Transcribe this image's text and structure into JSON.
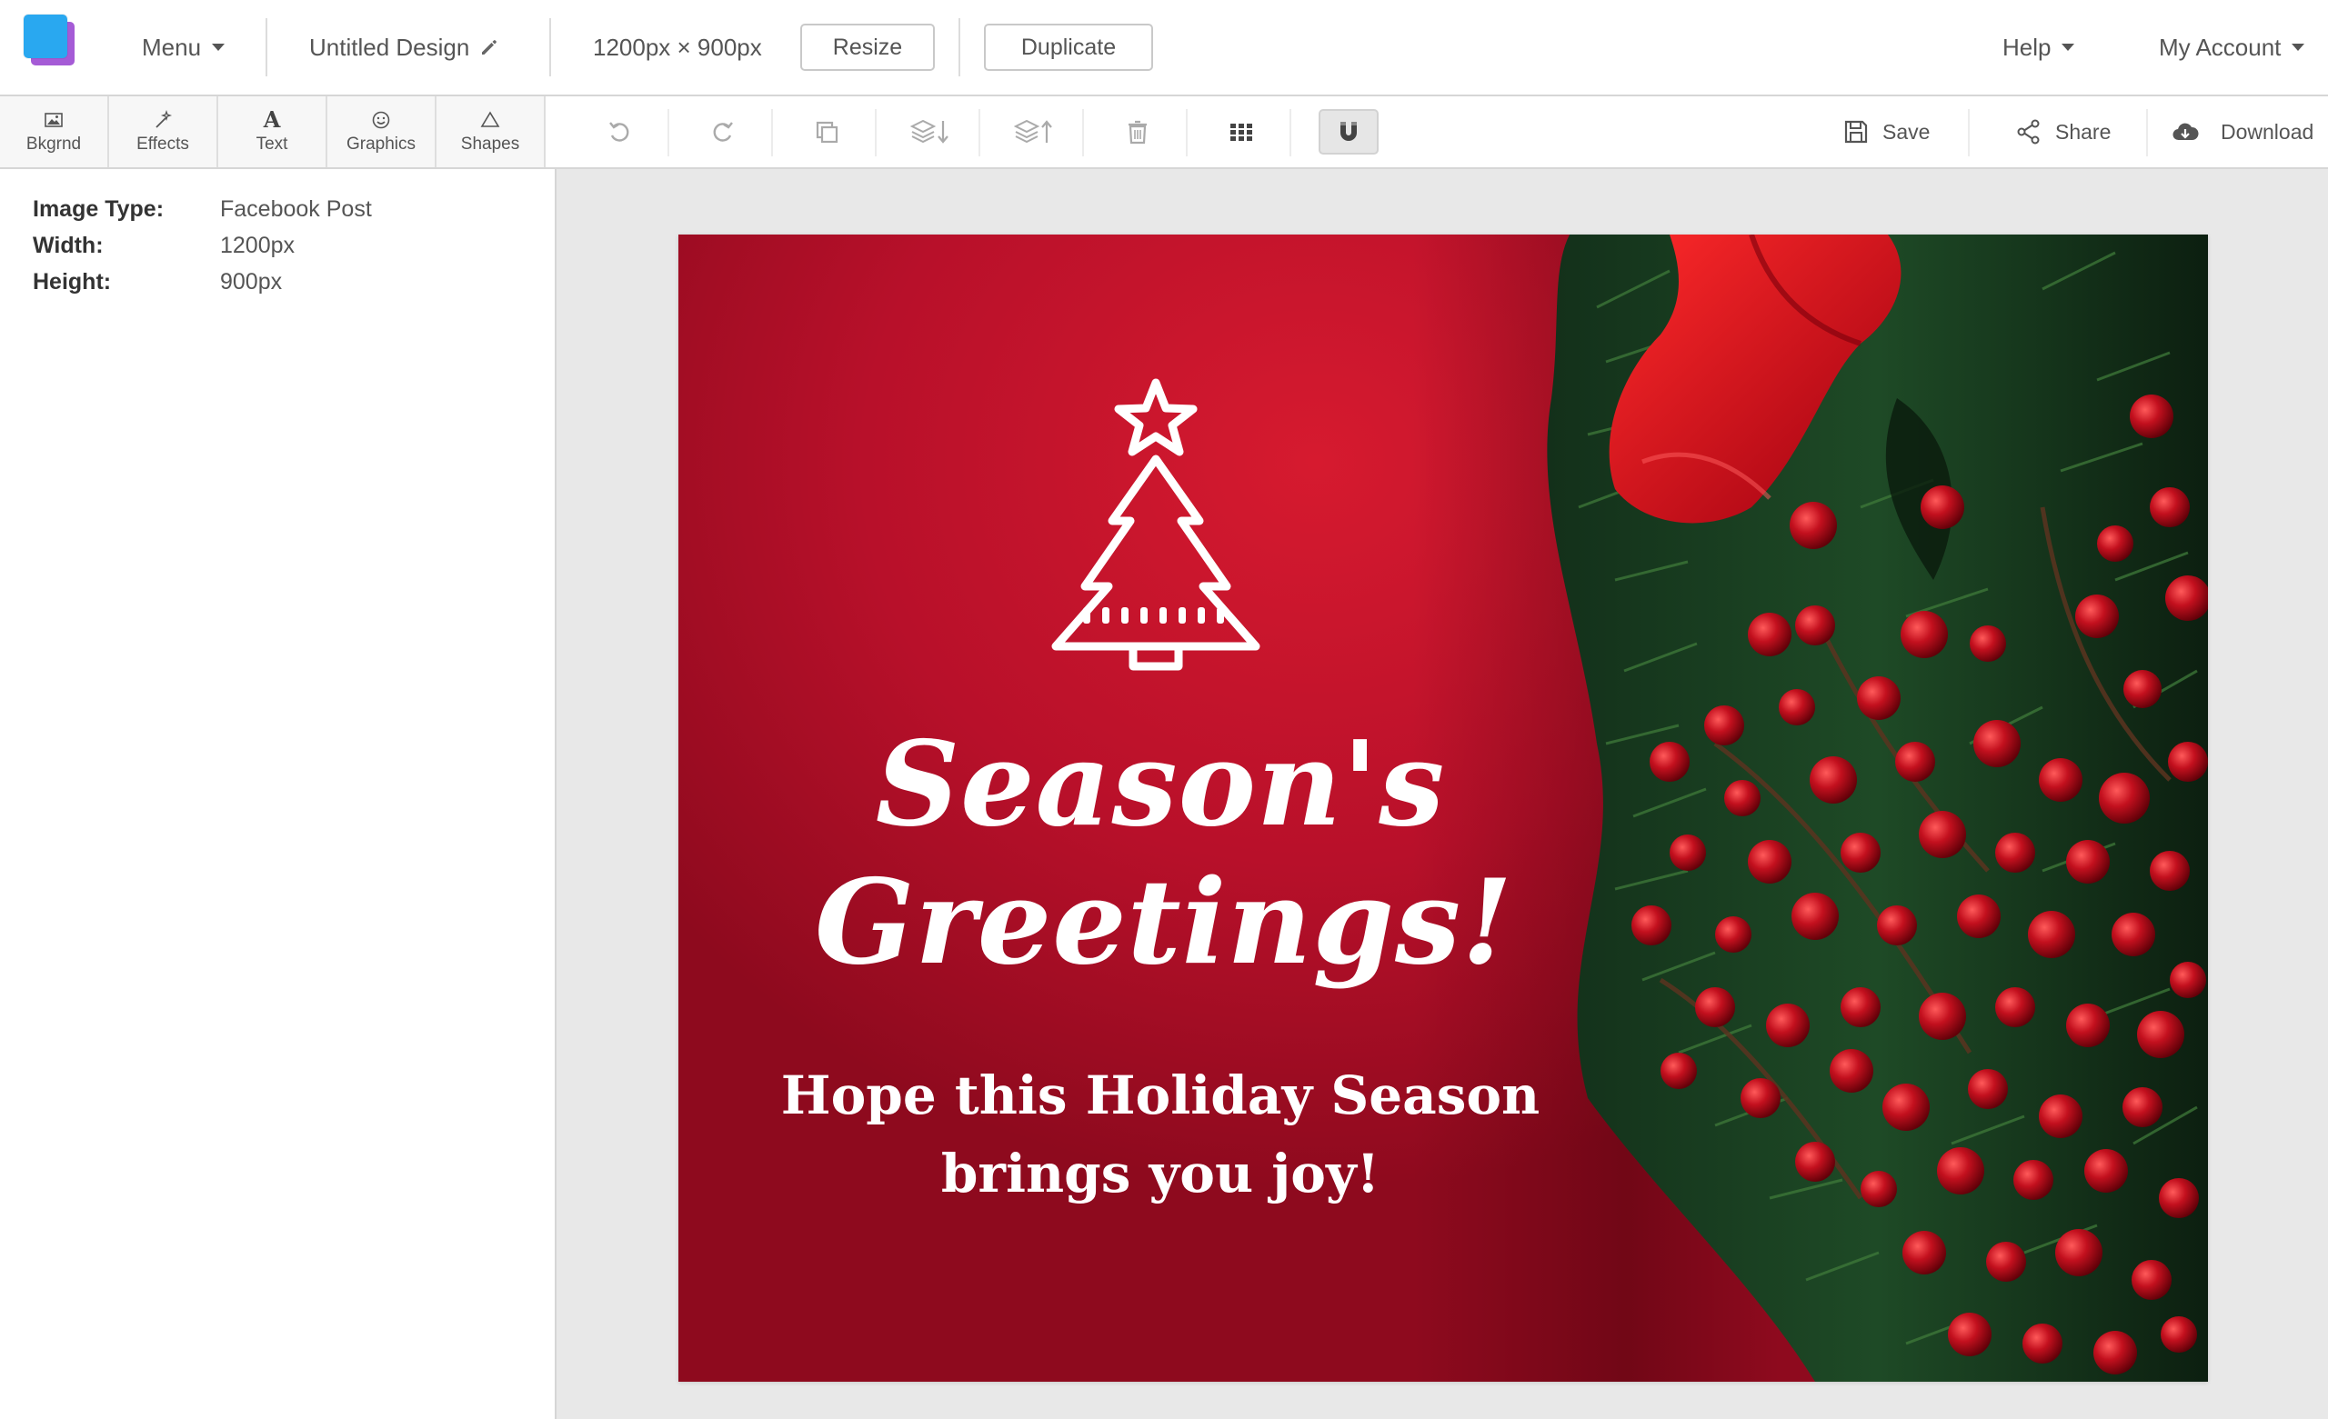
{
  "header": {
    "menu_label": "Menu",
    "design_title": "Untitled Design",
    "dimensions": "1200px × 900px",
    "resize_label": "Resize",
    "duplicate_label": "Duplicate",
    "help_label": "Help",
    "account_label": "My Account"
  },
  "tabs": [
    {
      "label": "Bkgrnd",
      "icon": "image-icon"
    },
    {
      "label": "Effects",
      "icon": "magic-wand-icon"
    },
    {
      "label": "Text",
      "icon": "text-icon"
    },
    {
      "label": "Graphics",
      "icon": "smiley-icon"
    },
    {
      "label": "Shapes",
      "icon": "triangle-icon"
    }
  ],
  "tools": [
    "undo-icon",
    "redo-icon",
    "copy-icon",
    "layer-down-icon",
    "layer-up-icon",
    "trash-icon",
    "grid-icon",
    "magnet-icon"
  ],
  "actions": {
    "save_label": "Save",
    "share_label": "Share",
    "download_label": "Download"
  },
  "properties": {
    "image_type_label": "Image Type:",
    "image_type_value": "Facebook Post",
    "width_label": "Width:",
    "width_value": "1200px",
    "height_label": "Height:",
    "height_value": "900px"
  },
  "canvas": {
    "headline_line1": "Season's",
    "headline_line2": "Greetings!",
    "subline_line1": "Hope this Holiday Season",
    "subline_line2": "brings you joy!",
    "background_color": "#c41230",
    "text_color": "#ffffff"
  },
  "colors": {
    "logo_front": "#29a8f0",
    "logo_back": "#a55bd6"
  }
}
